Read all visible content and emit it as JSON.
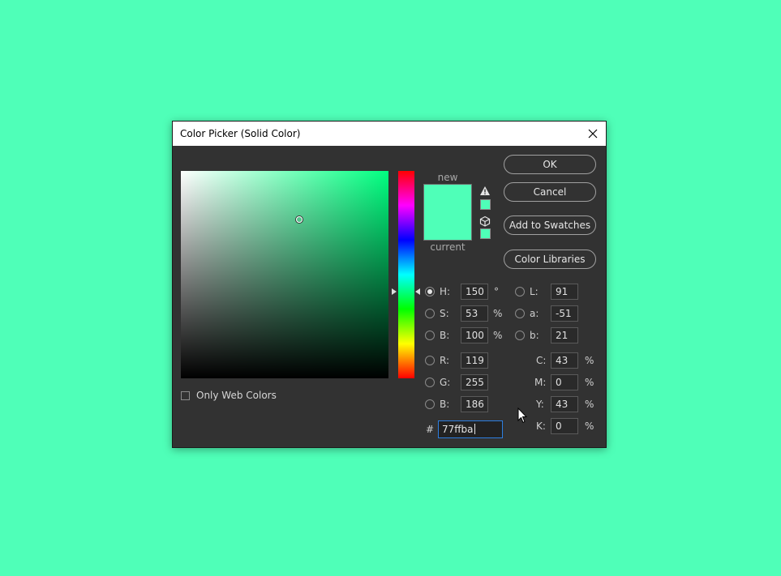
{
  "colors": {
    "background": "#4fffb8",
    "new_color": "#4fffb8",
    "current_color": "#4fffb8",
    "hue_pure": "#00ff80"
  },
  "dialog": {
    "title": "Color Picker (Solid Color)",
    "close_icon": "close-icon"
  },
  "swatches": {
    "new_label": "new",
    "current_label": "current"
  },
  "buttons": {
    "ok": "OK",
    "cancel": "Cancel",
    "add_to_swatches": "Add to Swatches",
    "color_libraries": "Color Libraries"
  },
  "only_web_colors": "Only Web Colors",
  "hsb": {
    "h": {
      "label": "H:",
      "value": "150",
      "unit": "°"
    },
    "s": {
      "label": "S:",
      "value": "53",
      "unit": "%"
    },
    "b": {
      "label": "B:",
      "value": "100",
      "unit": "%"
    }
  },
  "rgb": {
    "r": {
      "label": "R:",
      "value": "119"
    },
    "g": {
      "label": "G:",
      "value": "255"
    },
    "b": {
      "label": "B:",
      "value": "186"
    }
  },
  "lab": {
    "l": {
      "label": "L:",
      "value": "91"
    },
    "a": {
      "label": "a:",
      "value": "-51"
    },
    "b": {
      "label": "b:",
      "value": "21"
    }
  },
  "cmyk": {
    "c": {
      "label": "C:",
      "value": "43",
      "unit": "%"
    },
    "m": {
      "label": "M:",
      "value": "0",
      "unit": "%"
    },
    "y": {
      "label": "Y:",
      "value": "43",
      "unit": "%"
    },
    "k": {
      "label": "K:",
      "value": "0",
      "unit": "%"
    }
  },
  "hex": {
    "label": "#",
    "value": "77ffba"
  },
  "selected_mode": "H"
}
